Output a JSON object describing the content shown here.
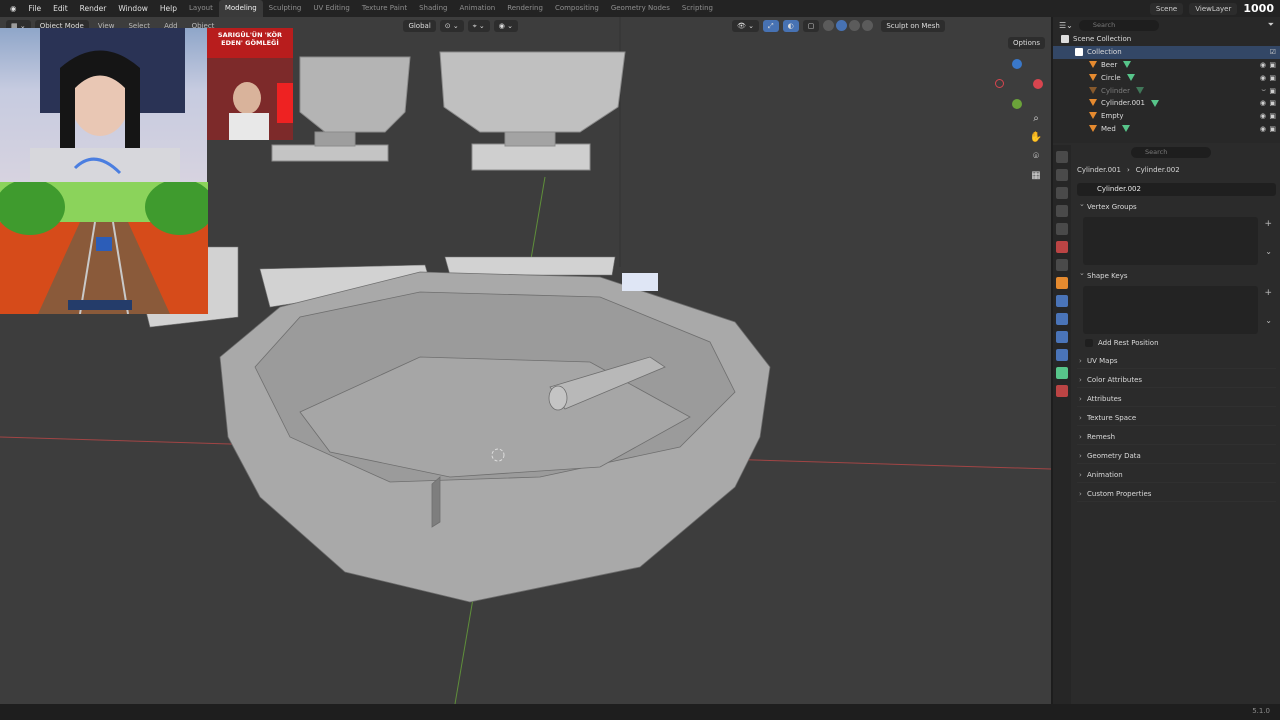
{
  "topbar": {
    "menu": [
      "File",
      "Edit",
      "Render",
      "Window",
      "Help"
    ],
    "workspaces": [
      "Layout",
      "Modeling",
      "Sculpting",
      "UV Editing",
      "Texture Paint",
      "Shading",
      "Animation",
      "Rendering",
      "Compositing",
      "Geometry Nodes",
      "Scripting"
    ],
    "active_workspace": "Modeling",
    "scene": "Scene",
    "view_layer": "ViewLayer",
    "counter": "1000"
  },
  "viewport_header": {
    "mode": "Object Mode",
    "view": "View",
    "select": "Select",
    "add": "Add",
    "object": "Object",
    "transform_orientation": "Global",
    "sculpt_button": "Sculpt on Mesh",
    "options": "Options"
  },
  "outliner": {
    "search_placeholder": "Search",
    "scene_collection": "Scene Collection",
    "collection": "Collection",
    "items": [
      {
        "name": "Beer"
      },
      {
        "name": "Circle"
      },
      {
        "name": "Cylinder"
      },
      {
        "name": "Cylinder.001"
      },
      {
        "name": "Empty"
      },
      {
        "name": "Med"
      }
    ]
  },
  "properties": {
    "search_placeholder": "Search",
    "breadcrumb_object": "Cylinder.001",
    "breadcrumb_mesh": "Cylinder.002",
    "mesh_name": "Cylinder.002",
    "vertex_groups": "Vertex Groups",
    "shape_keys": "Shape Keys",
    "add_rest_position": "Add Rest Position",
    "collapsed_sections": [
      "UV Maps",
      "Color Attributes",
      "Attributes",
      "Texture Space",
      "Remesh",
      "Geometry Data",
      "Animation",
      "Custom Properties"
    ]
  },
  "overlay": {
    "news_text": "SARIGÜL'ÜN 'KÖR EDEN' GÖMLEĞİ"
  },
  "status": {
    "version": "5.1.0"
  },
  "colors": {
    "accent": "#4772b3",
    "mesh_icon": "#57c58a",
    "object_icon": "#e58a2f"
  }
}
